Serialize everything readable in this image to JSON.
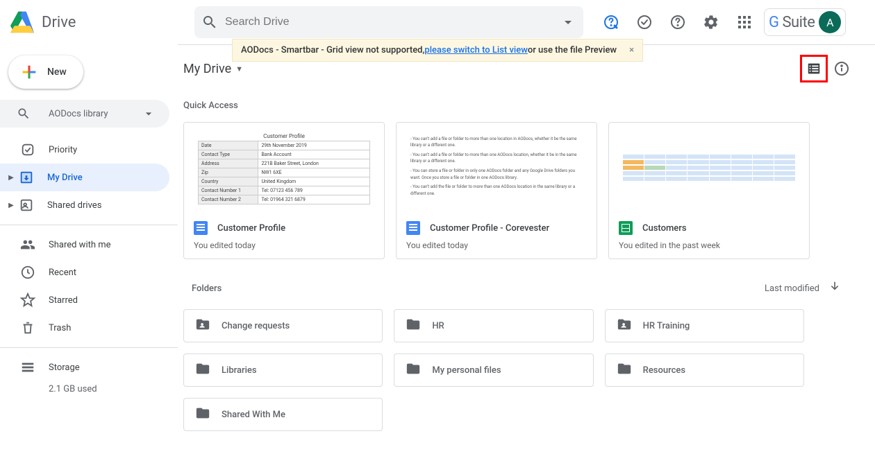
{
  "header": {
    "logo_text": "Drive",
    "search_placeholder": "Search Drive",
    "gsuite": "G Suite",
    "avatar_letter": "A"
  },
  "notice": {
    "prefix": "AODocs - Smartbar - Grid view not supported, ",
    "link": "please switch to List view",
    "suffix": " or use the file Preview",
    "close": "×"
  },
  "sidebar": {
    "new_button": "New",
    "library_filter": "AODocs library",
    "items": [
      {
        "label": "Priority",
        "expandable": false
      },
      {
        "label": "My Drive",
        "expandable": true,
        "active": true
      },
      {
        "label": "Shared drives",
        "expandable": true
      }
    ],
    "secondary": [
      {
        "label": "Shared with me"
      },
      {
        "label": "Recent"
      },
      {
        "label": "Starred"
      },
      {
        "label": "Trash"
      }
    ],
    "storage": {
      "label": "Storage",
      "used": "2.1 GB used"
    }
  },
  "main": {
    "breadcrumb": "My Drive",
    "quick_access_title": "Quick Access",
    "quick_access": [
      {
        "type": "docs",
        "title": "Customer Profile",
        "sub": "You edited today"
      },
      {
        "type": "docs",
        "title": "Customer Profile - Corevester",
        "sub": "You edited today"
      },
      {
        "type": "sheets",
        "title": "Customers",
        "sub": "You edited in the past week"
      }
    ],
    "folders_title": "Folders",
    "sort_label": "Last modified",
    "folders": [
      {
        "name": "Change requests",
        "shared": true
      },
      {
        "name": "HR",
        "shared": false
      },
      {
        "name": "HR Training",
        "shared": true
      },
      {
        "name": "Libraries",
        "shared": false
      },
      {
        "name": "My personal files",
        "shared": false
      },
      {
        "name": "Resources",
        "shared": false
      },
      {
        "name": "Shared With Me",
        "shared": false
      }
    ]
  }
}
